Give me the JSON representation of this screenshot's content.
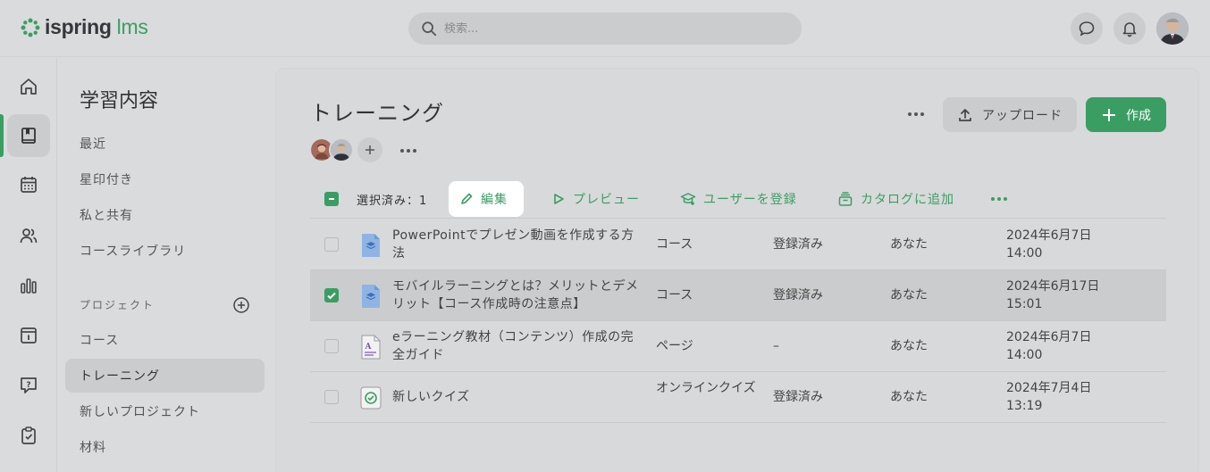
{
  "app": {
    "logo_main": "ispring",
    "logo_accent": "lms"
  },
  "search": {
    "placeholder": "検索..."
  },
  "sidenav": {
    "title": "学習内容",
    "items": [
      "最近",
      "星印付き",
      "私と共有",
      "コースライブラリ"
    ],
    "section_label": "プロジェクト",
    "projects": [
      "コース",
      "トレーニング",
      "新しいプロジェクト",
      "材料"
    ],
    "active_project": "トレーニング"
  },
  "main": {
    "title": "トレーニング",
    "upload_label": "アップロード",
    "create_label": "作成"
  },
  "toolbar": {
    "selected_text": "選択済み：1",
    "edit_label": "編集",
    "preview_label": "プレビュー",
    "enroll_label": "ユーザーを登録",
    "catalog_label": "カタログに追加"
  },
  "rows": [
    {
      "name": "PowerPointでプレゼン動画を作成する方法",
      "type": "コース",
      "status": "登録済み",
      "owner": "あなた",
      "date": "2024年6月7日",
      "time": "14:00",
      "icon": "course-icon",
      "selected": false
    },
    {
      "name": "モバイルラーニングとは？メリットとデメリット【コース作成時の注意点】",
      "type": "コース",
      "status": "登録済み",
      "owner": "あなた",
      "date": "2024年6月17日",
      "time": "15:01",
      "icon": "course-icon",
      "selected": true
    },
    {
      "name": "eラーニング教材（コンテンツ）作成の完全ガイド",
      "type": "ページ",
      "status": "–",
      "owner": "あなた",
      "date": "2024年6月7日",
      "time": "14:00",
      "icon": "page-icon",
      "selected": false
    },
    {
      "name": "新しいクイズ",
      "type": "オンラインクイズ",
      "status": "登録済み",
      "owner": "あなた",
      "date": "2024年7月4日",
      "time": "13:19",
      "icon": "quiz-icon",
      "selected": false
    }
  ],
  "colors": {
    "accent": "#3a9e63",
    "background": "#dadbdc",
    "selected_row": "#cbcccd"
  }
}
